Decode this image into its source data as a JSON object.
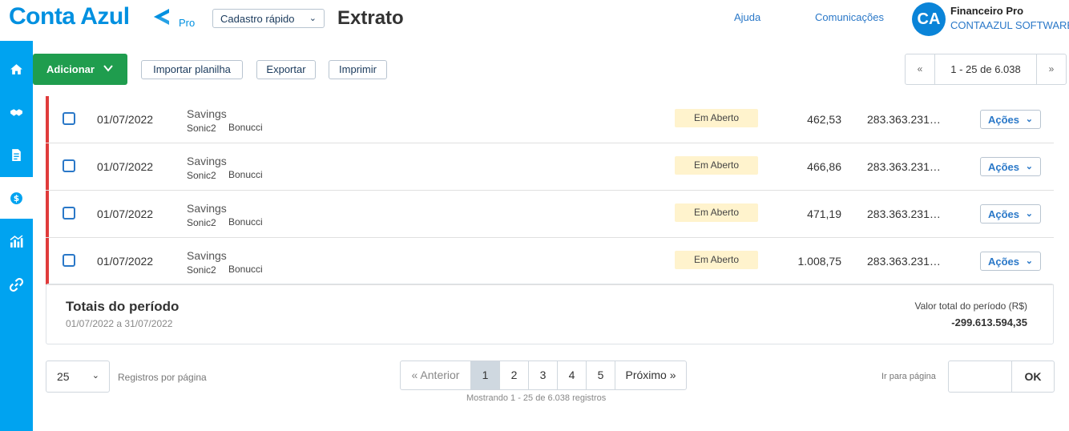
{
  "header": {
    "logo_text": "Conta Azul",
    "logo_tier": "Pro",
    "quick_register": "Cadastro rápido",
    "page_title": "Extrato",
    "help": "Ajuda",
    "communications": "Comunicações",
    "avatar_initials": "CA",
    "user_name": "Financeiro Pro",
    "company": "CONTAAZUL SOFTWARE"
  },
  "sidebar": {
    "items": [
      {
        "icon": "home-icon"
      },
      {
        "icon": "handshake-icon"
      },
      {
        "icon": "document-icon"
      },
      {
        "icon": "money-icon",
        "active": true
      },
      {
        "icon": "chart-icon"
      },
      {
        "icon": "link-icon"
      }
    ]
  },
  "toolbar": {
    "add": "Adicionar",
    "import": "Importar planilha",
    "export": "Exportar",
    "print": "Imprimir",
    "pager_prev": "«",
    "pager_range": "1 - 25 de 6.038",
    "pager_next": "»"
  },
  "rows": [
    {
      "date": "01/07/2022",
      "description": "Savings",
      "sub1": "Sonic2",
      "sub2": "Bonucci",
      "status": "Em Aberto",
      "value": "462,53",
      "balance": "283.363.231…",
      "actions": "Ações"
    },
    {
      "date": "01/07/2022",
      "description": "Savings",
      "sub1": "Sonic2",
      "sub2": "Bonucci",
      "status": "Em Aberto",
      "value": "466,86",
      "balance": "283.363.231…",
      "actions": "Ações"
    },
    {
      "date": "01/07/2022",
      "description": "Savings",
      "sub1": "Sonic2",
      "sub2": "Bonucci",
      "status": "Em Aberto",
      "value": "471,19",
      "balance": "283.363.231…",
      "actions": "Ações"
    },
    {
      "date": "01/07/2022",
      "description": "Savings",
      "sub1": "Sonic2",
      "sub2": "Bonucci",
      "status": "Em Aberto",
      "value": "1.008,75",
      "balance": "283.363.231…",
      "actions": "Ações"
    }
  ],
  "totals": {
    "title": "Totais do período",
    "range": "01/07/2022 a 31/07/2022",
    "label": "Valor total do período (R$)",
    "value": "-299.613.594,35"
  },
  "bottom": {
    "per_page": "25",
    "per_page_label": "Registros por página",
    "prev": "«  Anterior",
    "pages": [
      "1",
      "2",
      "3",
      "4",
      "5"
    ],
    "current_page": "1",
    "next": "Próximo  »",
    "showing": "Mostrando 1 - 25 de 6.038 registros",
    "goto_label": "Ir para página",
    "ok": "OK"
  },
  "colors": {
    "brand": "#0090e0",
    "sidebar": "#00a3f0",
    "add_button": "#1f9d4e",
    "status_bg": "#fff3cd",
    "row_marker": "#e03b3b"
  }
}
